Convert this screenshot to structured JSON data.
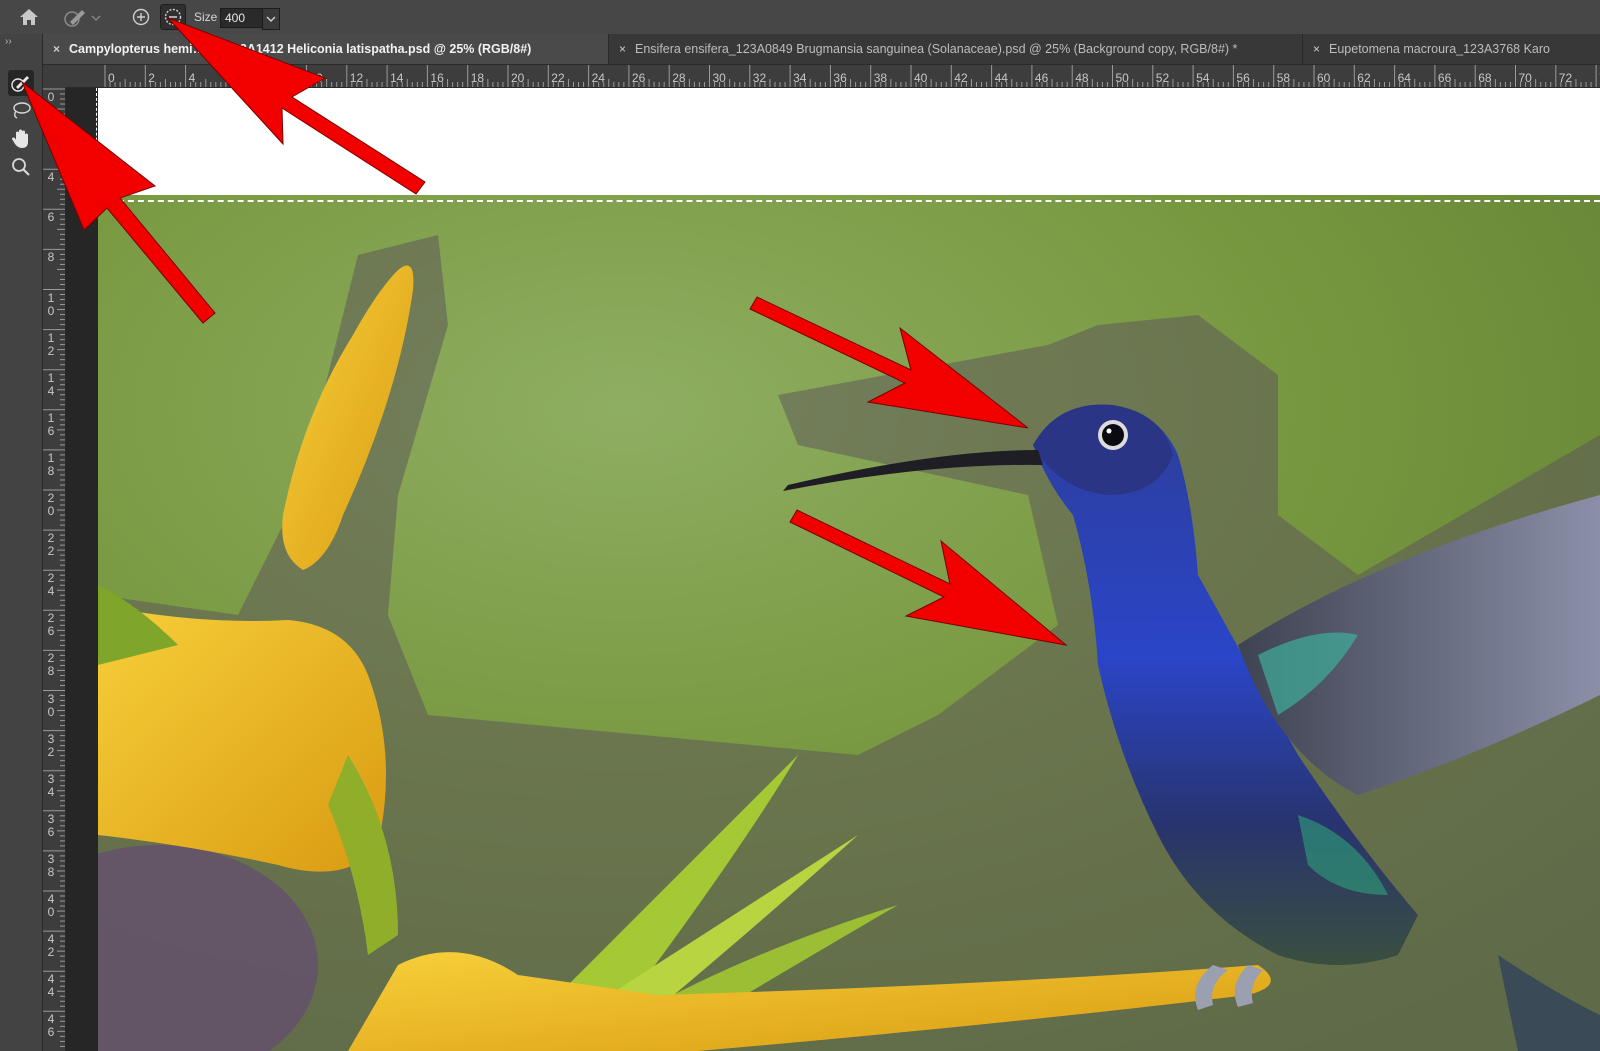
{
  "optionsbar": {
    "home_icon": "home-icon",
    "brush_icon": "quick-selection-brush-icon",
    "add_icon": "add-to-selection-icon",
    "subtract_icon": "subtract-from-selection-icon",
    "size_label": "Size",
    "size_value": "400"
  },
  "toolbar": {
    "collapse": "››",
    "tools": [
      {
        "name": "quick-selection-tool",
        "icon": "quick-selection-brush-icon",
        "active": true
      },
      {
        "name": "lasso-tool",
        "icon": "lasso-icon",
        "active": false
      },
      {
        "name": "hand-tool",
        "icon": "hand-icon",
        "active": false
      },
      {
        "name": "zoom-tool",
        "icon": "zoom-icon",
        "active": false
      }
    ]
  },
  "tabs": [
    {
      "close": "×",
      "label": "Campylopterus hemi… M_123A1412 Heliconia latispatha.psd @ 25% (RGB/8#)",
      "active": true
    },
    {
      "close": "×",
      "label": "Ensifera ensifera_123A0849 Brugmansia sanguinea (Solanaceae).psd @ 25% (Background copy, RGB/8#) *",
      "active": false
    },
    {
      "close": "×",
      "label": "Eupetomena macroura_123A3768 Karo",
      "active": false
    }
  ],
  "ruler": {
    "horizontal": [
      "0",
      "2",
      "4",
      "6",
      "8",
      "10",
      "12",
      "14",
      "16",
      "18",
      "20",
      "22",
      "24",
      "26",
      "28",
      "30",
      "32",
      "34",
      "36",
      "38",
      "40",
      "42",
      "44",
      "46",
      "48",
      "50",
      "52",
      "54",
      "56",
      "58",
      "60",
      "62",
      "64",
      "66",
      "68",
      "70",
      "72",
      "7"
    ],
    "vertical": [
      "0",
      "2",
      "4",
      "6",
      "8",
      "10",
      "12",
      "14",
      "16",
      "18",
      "20",
      "22",
      "24",
      "26",
      "28",
      "30",
      "32",
      "34",
      "36",
      "38",
      "40",
      "42",
      "44",
      "46"
    ]
  },
  "colors": {
    "annotation_arrow": "#f20000",
    "background_green": "#7a9a4a",
    "hummingbird_blue": "#2e3fb0",
    "flower_yellow": "#f2b51f"
  }
}
